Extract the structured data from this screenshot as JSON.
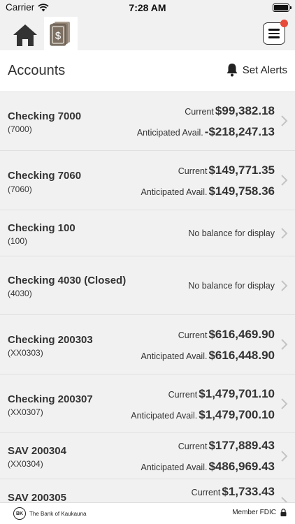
{
  "status": {
    "carrier": "Carrier",
    "time": "7:28 AM"
  },
  "nav": {
    "home_icon": "home-icon",
    "accounts_icon": "money-stack-icon",
    "menu_icon": "hamburger-menu-icon"
  },
  "header": {
    "title": "Accounts",
    "set_alerts": "Set Alerts"
  },
  "accounts": [
    {
      "name": "Checking 7000",
      "number": "(7000)",
      "current_label": "Current",
      "current": "$99,382.18",
      "avail_label": "Anticipated Avail.",
      "avail": "-$218,247.13"
    },
    {
      "name": "Checking 7060",
      "number": "(7060)",
      "current_label": "Current",
      "current": "$149,771.35",
      "avail_label": "Anticipated Avail.",
      "avail": "$149,758.36"
    },
    {
      "name": "Checking 100",
      "number": "(100)",
      "no_balance": "No balance for display"
    },
    {
      "name": "Checking 4030 (Closed)",
      "number": "(4030)",
      "no_balance": "No balance for display"
    },
    {
      "name": "Checking 200303",
      "number": "(XX0303)",
      "current_label": "Current",
      "current": "$616,469.90",
      "avail_label": "Anticipated Avail.",
      "avail": "$616,448.90"
    },
    {
      "name": "Checking 200307",
      "number": "(XX0307)",
      "current_label": "Current",
      "current": "$1,479,701.10",
      "avail_label": "Anticipated Avail.",
      "avail": "$1,479,700.10"
    },
    {
      "name": "SAV 200304",
      "number": "(XX0304)",
      "current_label": "Current",
      "current": "$177,889.43",
      "avail_label": "Anticipated Avail.",
      "avail": "$486,969.43"
    },
    {
      "name": "SAV 200305",
      "number": "",
      "current_label": "Current",
      "current": "$1,733.43"
    }
  ],
  "footer": {
    "bank_name": "The Bank of Kaukauna",
    "logo_text": "BK",
    "fdic": "Member FDIC"
  },
  "colors": {
    "background": "#f2f1f1",
    "alert_dot": "#e84a3a",
    "text": "#333333"
  }
}
